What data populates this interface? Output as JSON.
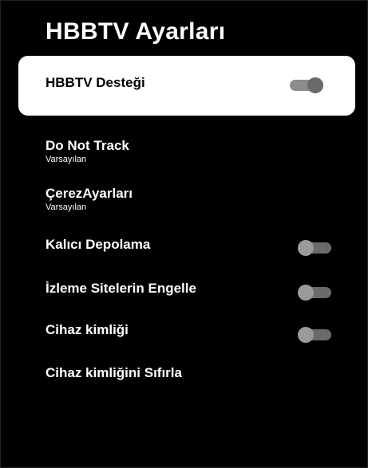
{
  "page": {
    "title": "HBBTV Ayarları"
  },
  "menu": {
    "hbbtv_support": {
      "label": "HBBTV Desteği",
      "state": "on"
    },
    "do_not_track": {
      "label": "Do Not Track",
      "value": "Varsayılan"
    },
    "cookie_settings": {
      "label": "ÇerezAyarları",
      "value": "Varsayılan"
    },
    "persistent_storage": {
      "label": "Kalıcı Depolama",
      "state": "off"
    },
    "block_tracking_sites": {
      "label": "İzleme Sitelerin Engelle",
      "state": "off"
    },
    "device_id": {
      "label": "Cihaz kimliği",
      "state": "off"
    },
    "reset_device_id": {
      "label": "Cihaz kimliğini Sıfırla"
    }
  },
  "colors": {
    "background": "#000000",
    "focus_card": "#ffffff",
    "toggle_on_track": "#8c8c8c",
    "toggle_off_track": "#6a6a6a"
  }
}
